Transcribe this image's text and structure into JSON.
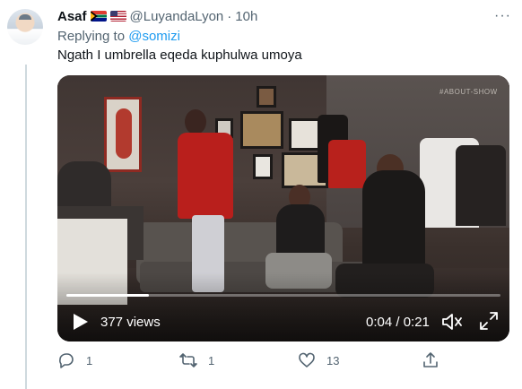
{
  "tweet": {
    "author_name": "Asaf",
    "author_handle": "@LuyandaLyon",
    "separator": "·",
    "time": "10h",
    "more_icon": "more-horizontal-icon",
    "replying_to_label": "Replying to",
    "replying_to_handle": "@somizi",
    "text": "Ngath I umbrella eqeda kuphulwa umoya",
    "flags": [
      "south-africa-flag",
      "us-flag"
    ]
  },
  "video": {
    "views": "377 views",
    "timecode": "0:04 / 0:21",
    "progress": 0.19,
    "watermark": "#ABOUT-SHOW",
    "controls": [
      "play-icon",
      "mute-icon",
      "fullscreen-icon"
    ]
  },
  "actions": {
    "reply_count": "1",
    "retweet_count": "1",
    "like_count": "13",
    "icons": [
      "reply-icon",
      "retweet-icon",
      "like-icon",
      "share-icon"
    ]
  },
  "colors": {
    "accent": "#1d9bf0",
    "secondary_text": "#536471",
    "primary_text": "#0f1419"
  }
}
